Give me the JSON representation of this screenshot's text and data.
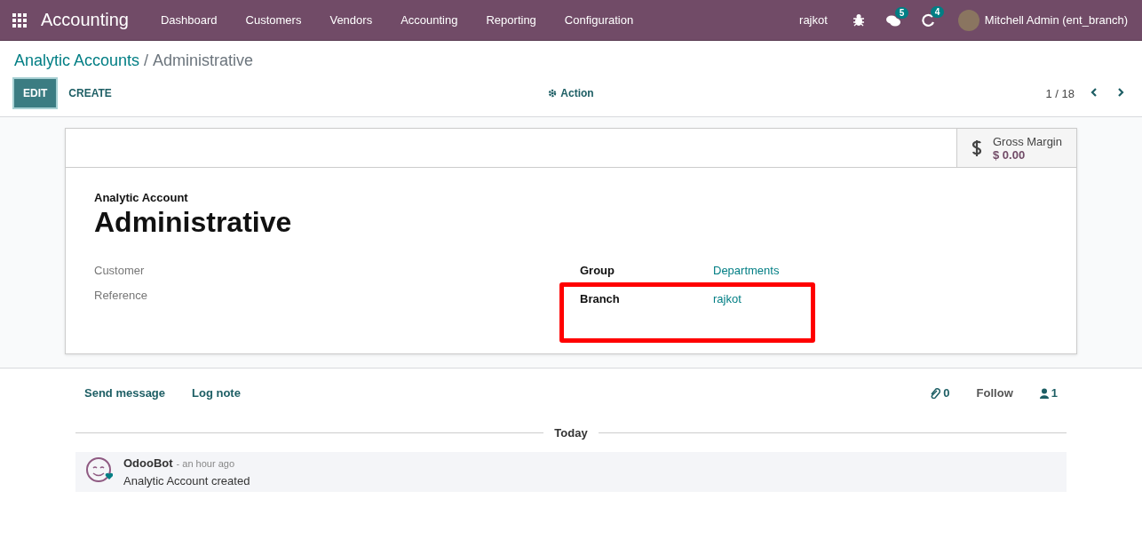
{
  "navbar": {
    "app_name": "Accounting",
    "menu": [
      "Dashboard",
      "Customers",
      "Vendors",
      "Accounting",
      "Reporting",
      "Configuration"
    ],
    "branch": "rajkot",
    "messages_count": "5",
    "activities_count": "4",
    "user": "Mitchell Admin (ent_branch)"
  },
  "breadcrumb": {
    "parent": "Analytic Accounts",
    "separator": "/",
    "current": "Administrative"
  },
  "buttons": {
    "edit": "EDIT",
    "create": "CREATE",
    "action": "Action"
  },
  "pager": {
    "value": "1 / 18"
  },
  "smart_button": {
    "label": "Gross Margin",
    "value": "$ 0.00"
  },
  "form": {
    "type_label": "Analytic Account",
    "name": "Administrative",
    "left_fields": [
      {
        "label": "Customer"
      },
      {
        "label": "Reference"
      }
    ],
    "right_fields": [
      {
        "label": "Group",
        "value": "Departments",
        "highlighted": false
      },
      {
        "label": "Branch",
        "value": "rajkot",
        "highlighted": true
      }
    ]
  },
  "chatter": {
    "send_message": "Send message",
    "log_note": "Log note",
    "attachments": "0",
    "follow": "Follow",
    "followers": "1",
    "date_separator": "Today",
    "messages": [
      {
        "author": "OdooBot",
        "time": "- an hour ago",
        "body": "Analytic Account created"
      }
    ]
  }
}
